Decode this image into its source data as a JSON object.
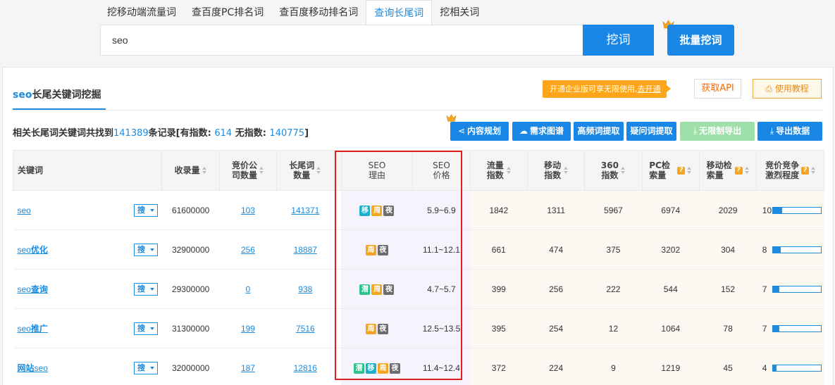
{
  "tabs": [
    {
      "label": "挖移动端流量词",
      "active": false
    },
    {
      "label": "查百度PC排名词",
      "active": false
    },
    {
      "label": "查百度移动排名词",
      "active": false
    },
    {
      "label": "查询长尾词",
      "active": true
    },
    {
      "label": "挖相关词",
      "active": false
    }
  ],
  "search": {
    "value": "seo",
    "dig_label": "挖词",
    "batch_label": "批量挖词"
  },
  "panel": {
    "title_kw": "seo",
    "title_rest": "长尾关键词挖掘",
    "promo_text": "开通企业版可享无限使用,",
    "promo_link": "去开通",
    "api_label": "获取API",
    "tutorial_label": "使用教程"
  },
  "summary": {
    "prefix": "相关长尾词关键词共找到",
    "total": "141389",
    "mid": "条记录[有指数:",
    "with_index": "614",
    "no_index_label": "无指数:",
    "no_index": "140775",
    "suffix": "]"
  },
  "toolbar": {
    "content_plan": "内容规划",
    "demand_graph": "需求图谱",
    "high_freq": "高频词提取",
    "question": "疑问词提取",
    "unlimited_export": "无限制导出",
    "export": "导出数据"
  },
  "table": {
    "headers": {
      "keyword": "关键词",
      "index_count": "收录量",
      "bid_companies": "竞价公司数量",
      "longtail_count": "长尾词数量",
      "seo_reason": "SEO理由",
      "seo_price": "SEO价格",
      "traffic_index": "流量指数",
      "mobile_index": "移动指数",
      "index_360": "360指数",
      "pc_search": "PC检索量",
      "mobile_search": "移动检索量",
      "competition": "竞价竞争激烈程度"
    },
    "search_btn": "搜",
    "rows": [
      {
        "pre": "",
        "hl": "seo",
        "post": "",
        "index_count": "61600000",
        "bid": "103",
        "longtail": "141371",
        "tags": [
          "移",
          "周",
          "夜"
        ],
        "price": "5.9~6.9",
        "traffic": "1842",
        "mobile": "1311",
        "i360": "5967",
        "pc": "6974",
        "msearch": "2029",
        "comp": "10",
        "comp_level": 0.2
      },
      {
        "pre": "",
        "hl": "seo",
        "post": "优化",
        "index_count": "32900000",
        "bid": "256",
        "longtail": "18887",
        "tags": [
          "周",
          "夜"
        ],
        "price": "11.1~12.1",
        "traffic": "661",
        "mobile": "474",
        "i360": "375",
        "pc": "3202",
        "msearch": "304",
        "comp": "8",
        "comp_level": 0.16
      },
      {
        "pre": "",
        "hl": "seo",
        "post": "查询",
        "index_count": "29300000",
        "bid": "0",
        "longtail": "938",
        "tags": [
          "潜",
          "周",
          "夜"
        ],
        "price": "4.7~5.7",
        "traffic": "399",
        "mobile": "256",
        "i360": "222",
        "pc": "544",
        "msearch": "152",
        "comp": "7",
        "comp_level": 0.14
      },
      {
        "pre": "",
        "hl": "seo",
        "post": "推广",
        "index_count": "31300000",
        "bid": "199",
        "longtail": "7516",
        "tags": [
          "周",
          "夜"
        ],
        "price": "12.5~13.5",
        "traffic": "395",
        "mobile": "254",
        "i360": "12",
        "pc": "1064",
        "msearch": "78",
        "comp": "7",
        "comp_level": 0.14
      },
      {
        "pre": "网站",
        "hl": "seo",
        "post": "",
        "index_count": "32000000",
        "bid": "187",
        "longtail": "12816",
        "tags": [
          "潜",
          "移",
          "周",
          "夜"
        ],
        "price": "11.4~12.4",
        "traffic": "372",
        "mobile": "224",
        "i360": "9",
        "pc": "1219",
        "msearch": "45",
        "comp": "4",
        "comp_level": 0.08
      }
    ]
  },
  "colors": {
    "accent": "#1a87e6",
    "highlight_box": "#e02020",
    "promo": "#fda61a"
  }
}
